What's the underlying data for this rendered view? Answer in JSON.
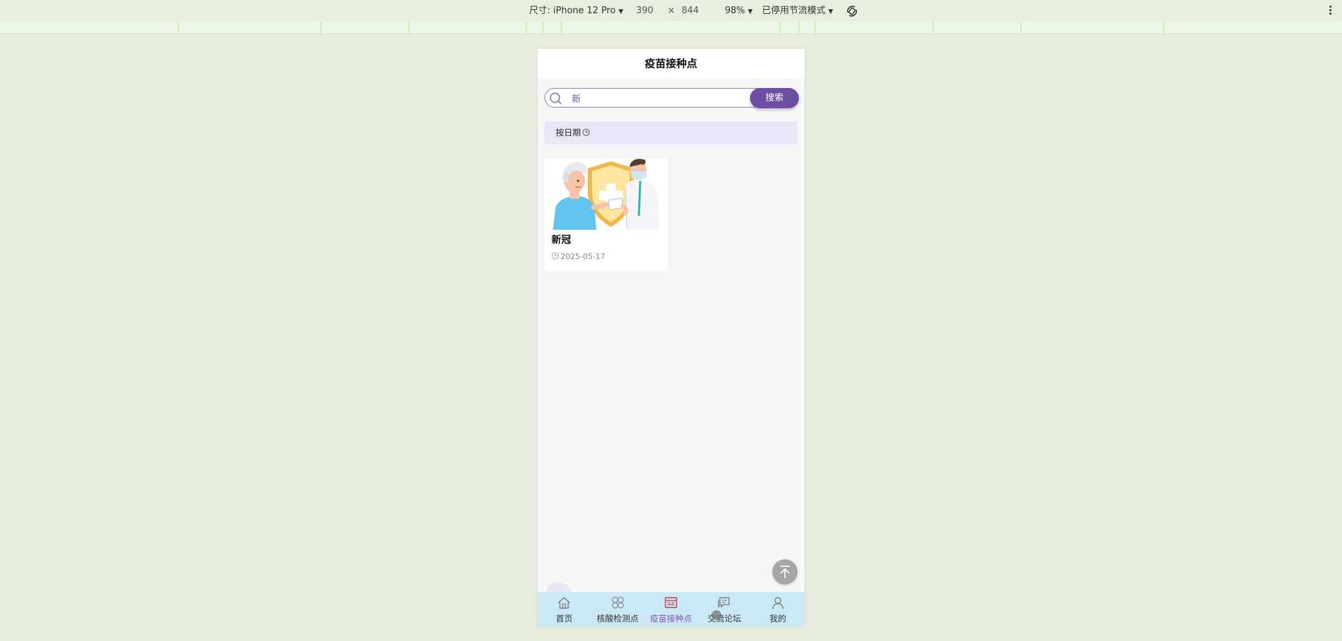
{
  "devtools": {
    "device_label": "尺寸: iPhone 12 Pro",
    "width": "390",
    "times": "×",
    "height": "844",
    "zoom": "98%",
    "throttle": "已停用节流模式",
    "rotate_icon": "rotate-icon",
    "more_icon": "more-vert-icon"
  },
  "page": {
    "title": "疫苗接种点"
  },
  "search": {
    "value": "新",
    "button_label": "搜索",
    "icon": "search-icon"
  },
  "filter": {
    "label": "按日期"
  },
  "cards": [
    {
      "title": "新冠",
      "date": "2025-05-17"
    }
  ],
  "tabbar": {
    "items": [
      {
        "label": "首页",
        "icon": "home-icon",
        "active": false
      },
      {
        "label": "核酸检测点",
        "icon": "grid-icon",
        "active": false
      },
      {
        "label": "疫苗接种点",
        "icon": "calendar-icon",
        "active": true
      },
      {
        "label": "交流论坛",
        "icon": "chat-icon",
        "active": false
      },
      {
        "label": "我的",
        "icon": "user-icon",
        "active": false
      }
    ]
  },
  "colors": {
    "accent": "#6d4ea3",
    "tab_active": "#7b5ab6",
    "tabbar_bg": "#cbe8f6",
    "filter_bg": "#ece6f9"
  }
}
